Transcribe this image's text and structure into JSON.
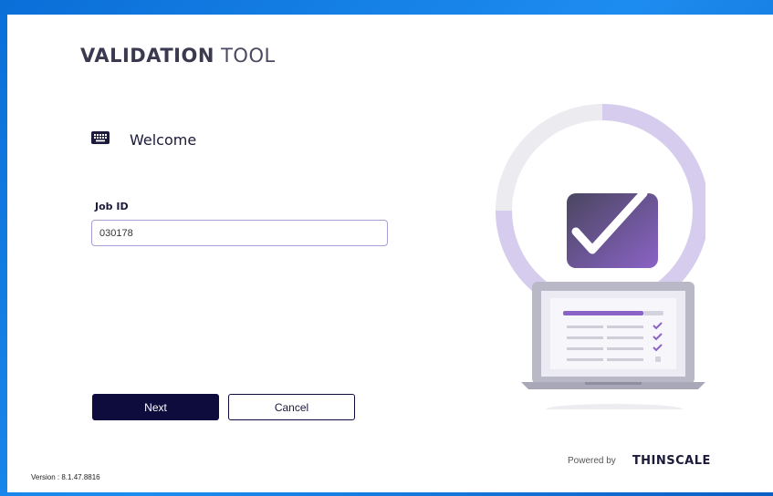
{
  "app": {
    "title_bold": "VALIDATION",
    "title_light": " TOOL"
  },
  "welcome": {
    "text": "Welcome",
    "icon": "keyboard-icon"
  },
  "form": {
    "job_id_label": "Job ID",
    "job_id_value": "030178"
  },
  "buttons": {
    "next": "Next",
    "cancel": "Cancel"
  },
  "footer": {
    "powered_by": "Powered by",
    "brand": "THINSCALE",
    "version": "Version : 8.1.47.8816"
  },
  "colors": {
    "primary": "#0e0b3d",
    "accent": "#8a6fc2",
    "ring": "#d8d0ec",
    "input_border": "#a59fd6"
  }
}
